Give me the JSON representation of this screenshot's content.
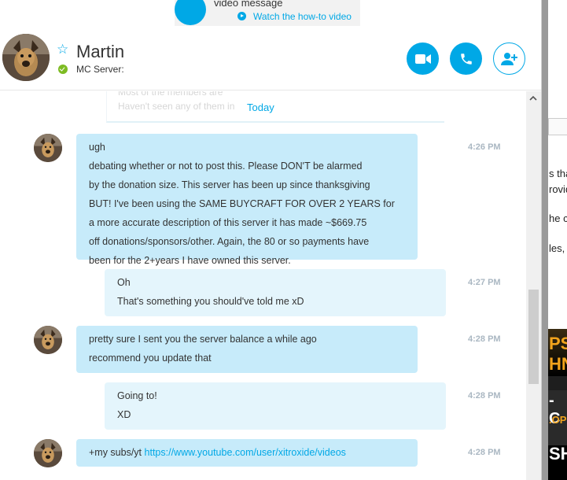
{
  "banner": {
    "title": "video message",
    "howto_link": "Watch the how-to video"
  },
  "header": {
    "contact_name": "Martin",
    "mood": "MC Server:",
    "status_color": "#7dbb23",
    "accent_color": "#00a8e6",
    "buttons": [
      "video-call",
      "audio-call",
      "add-people"
    ]
  },
  "conversation": {
    "faded_quote": [
      "Most of the members are",
      "Haven't seen any of them in"
    ],
    "date_divider": "Today",
    "messages": [
      {
        "direction": "incoming",
        "time": "4:26 PM",
        "lines": [
          "ugh",
          "debating whether or not to post this. Please DON'T be alarmed",
          "by the donation size. This server has been up since thanksgiving",
          "BUT! I've been using the SAME BUYCRAFT FOR OVER 2 YEARS for",
          "a more accurate description of this server it has made ~$669.75",
          "off donations/sponsors/other. Again, the 80 or so payments have",
          "been for the 2+years I have owned this server."
        ]
      },
      {
        "direction": "outgoing",
        "time": "4:27 PM",
        "lines": [
          "Oh",
          "That's something you should've told me xD"
        ]
      },
      {
        "direction": "incoming",
        "time": "4:28 PM",
        "lines": [
          "pretty sure I sent you the server balance a while ago",
          "recommend you update that"
        ]
      },
      {
        "direction": "outgoing",
        "time": "4:28 PM",
        "lines": [
          "Going to!",
          "XD"
        ]
      },
      {
        "direction": "incoming",
        "time": "4:28 PM",
        "prefix": "+my subs/yt",
        "link": "https://www.youtube.com/user/xitroxide/videos"
      }
    ]
  },
  "background_window": {
    "fragments": [
      "s tha",
      "rovid",
      "he c",
      "les, t"
    ],
    "image_text": [
      "PS",
      "HN",
      "- C",
      ".OPO",
      "SH"
    ]
  }
}
